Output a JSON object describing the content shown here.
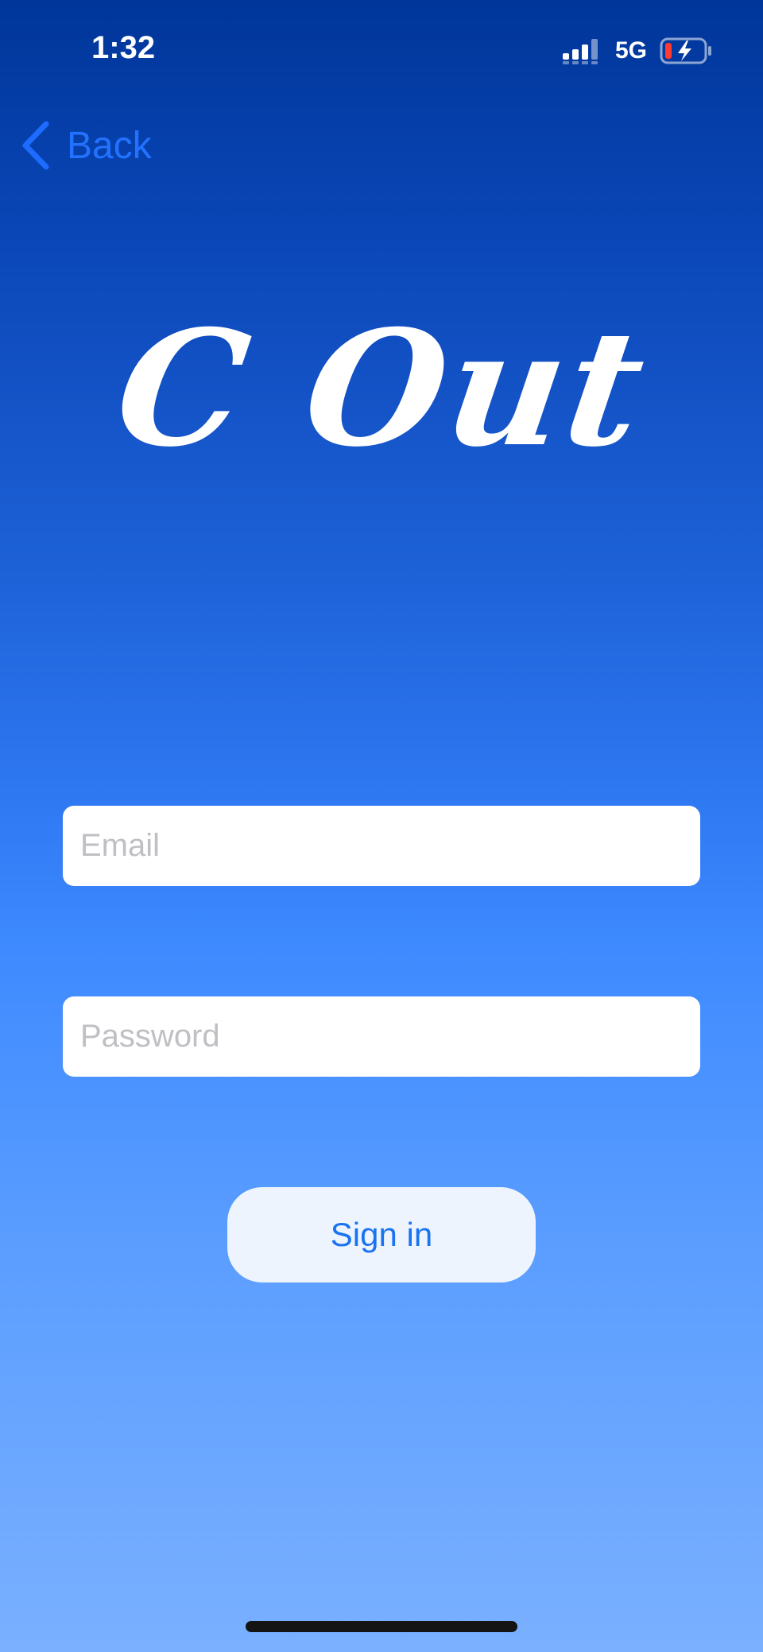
{
  "status_bar": {
    "time": "1:32",
    "network": "5G",
    "signal_icon": "cellular-signal-icon",
    "battery_icon": "battery-charging-icon",
    "battery_level_color": "#FF3B30"
  },
  "nav": {
    "back_label": "Back",
    "back_icon": "chevron-left-icon"
  },
  "logo": {
    "text": "C Out"
  },
  "form": {
    "email": {
      "value": "",
      "placeholder": "Email"
    },
    "password": {
      "value": "",
      "placeholder": "Password"
    },
    "submit_label": "Sign in"
  },
  "colors": {
    "background_top": "#00369A",
    "background_bottom": "#7AB0FF",
    "accent": "#1A73F0",
    "button_background": "#EEF4FE"
  }
}
